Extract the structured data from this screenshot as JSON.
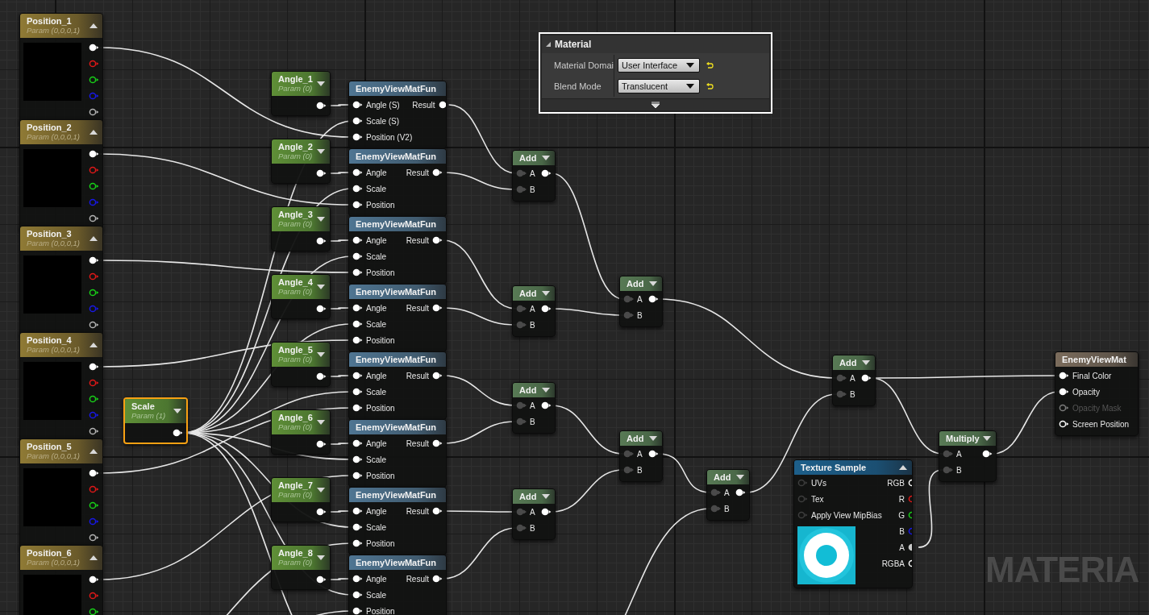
{
  "panel": {
    "title": "Material",
    "expanded": true,
    "rows": [
      {
        "label": "Material Domai",
        "value": "User Interface"
      },
      {
        "label": "Blend Mode",
        "value": "Translucent"
      }
    ]
  },
  "nodes": [
    {
      "kind": "vector_param",
      "title": "Position_1",
      "subtitle": "Param (0,0,0,1)",
      "selected": false,
      "outputs": [
        {
          "color": "#ffffff",
          "connected": true
        },
        {
          "color": "#e01818",
          "connected": false
        },
        {
          "color": "#18d018",
          "connected": false
        },
        {
          "color": "#1818e8",
          "connected": false
        },
        {
          "color": "#b4b4b4",
          "connected": false
        }
      ]
    },
    {
      "kind": "vector_param",
      "title": "Position_2",
      "subtitle": "Param (0,0,0,1)",
      "selected": false,
      "outputs": [
        {
          "color": "#ffffff",
          "connected": true
        },
        {
          "color": "#e01818",
          "connected": false
        },
        {
          "color": "#18d018",
          "connected": false
        },
        {
          "color": "#1818e8",
          "connected": false
        },
        {
          "color": "#b4b4b4",
          "connected": false
        }
      ]
    },
    {
      "kind": "vector_param",
      "title": "Position_3",
      "subtitle": "Param (0,0,0,1)",
      "selected": false,
      "outputs": [
        {
          "color": "#ffffff",
          "connected": true
        },
        {
          "color": "#e01818",
          "connected": false
        },
        {
          "color": "#18d018",
          "connected": false
        },
        {
          "color": "#1818e8",
          "connected": false
        },
        {
          "color": "#b4b4b4",
          "connected": false
        }
      ]
    },
    {
      "kind": "vector_param",
      "title": "Position_4",
      "subtitle": "Param (0,0,0,1)",
      "selected": false,
      "outputs": [
        {
          "color": "#ffffff",
          "connected": true
        },
        {
          "color": "#e01818",
          "connected": false
        },
        {
          "color": "#18d018",
          "connected": false
        },
        {
          "color": "#1818e8",
          "connected": false
        },
        {
          "color": "#b4b4b4",
          "connected": false
        }
      ]
    },
    {
      "kind": "vector_param",
      "title": "Position_5",
      "subtitle": "Param (0,0,0,1)",
      "selected": false,
      "outputs": [
        {
          "color": "#ffffff",
          "connected": true
        },
        {
          "color": "#e01818",
          "connected": false
        },
        {
          "color": "#18d018",
          "connected": false
        },
        {
          "color": "#1818e8",
          "connected": false
        },
        {
          "color": "#b4b4b4",
          "connected": false
        }
      ]
    },
    {
      "kind": "vector_param",
      "title": "Position_6",
      "subtitle": "Param (0,0,0,1)",
      "selected": false,
      "outputs": [
        {
          "color": "#ffffff",
          "connected": true
        },
        {
          "color": "#e01818",
          "connected": false
        },
        {
          "color": "#18d018",
          "connected": false
        }
      ]
    },
    {
      "kind": "scalar_param",
      "title": "Scale",
      "subtitle": "Param (1)",
      "selected": true,
      "output": {
        "connected": true
      }
    },
    {
      "kind": "scalar_param",
      "title": "Angle_1",
      "subtitle": "Param (0)",
      "selected": false,
      "output": {
        "connected": true
      }
    },
    {
      "kind": "scalar_param",
      "title": "Angle_2",
      "subtitle": "Param (0)",
      "selected": false,
      "output": {
        "connected": true
      }
    },
    {
      "kind": "scalar_param",
      "title": "Angle_3",
      "subtitle": "Param (0)",
      "selected": false,
      "output": {
        "connected": true
      }
    },
    {
      "kind": "scalar_param",
      "title": "Angle_4",
      "subtitle": "Param (0)",
      "selected": false,
      "output": {
        "connected": true
      }
    },
    {
      "kind": "scalar_param",
      "title": "Angle_5",
      "subtitle": "Param (0)",
      "selected": false,
      "output": {
        "connected": true
      }
    },
    {
      "kind": "scalar_param",
      "title": "Angle_6",
      "subtitle": "Param (0)",
      "selected": false,
      "output": {
        "connected": true
      }
    },
    {
      "kind": "scalar_param",
      "title": "Angle_7",
      "subtitle": "Param (0)",
      "selected": false,
      "output": {
        "connected": true
      }
    },
    {
      "kind": "scalar_param",
      "title": "Angle_8",
      "subtitle": "Param (0)",
      "selected": false,
      "output": {
        "connected": true
      }
    },
    {
      "kind": "function_call",
      "title": "EnemyViewMatFun",
      "inputs": [
        {
          "label": "Angle (S)",
          "connected": true
        },
        {
          "label": "Scale (S)",
          "connected": true
        },
        {
          "label": "Position (V2)",
          "connected": true
        }
      ],
      "outputs": [
        {
          "label": "Result",
          "connected": true
        }
      ]
    },
    {
      "kind": "function_call",
      "title": "EnemyViewMatFun",
      "inputs": [
        {
          "label": "Angle",
          "connected": true
        },
        {
          "label": "Scale",
          "connected": true
        },
        {
          "label": "Position",
          "connected": true
        }
      ],
      "outputs": [
        {
          "label": "Result",
          "connected": true
        }
      ]
    },
    {
      "kind": "function_call",
      "title": "EnemyViewMatFun",
      "inputs": [
        {
          "label": "Angle",
          "connected": true
        },
        {
          "label": "Scale",
          "connected": true
        },
        {
          "label": "Position",
          "connected": true
        }
      ],
      "outputs": [
        {
          "label": "Result",
          "connected": true
        }
      ]
    },
    {
      "kind": "function_call",
      "title": "EnemyViewMatFun",
      "inputs": [
        {
          "label": "Angle",
          "connected": true
        },
        {
          "label": "Scale",
          "connected": true
        },
        {
          "label": "Position",
          "connected": true
        }
      ],
      "outputs": [
        {
          "label": "Result",
          "connected": true
        }
      ]
    },
    {
      "kind": "function_call",
      "title": "EnemyViewMatFun",
      "inputs": [
        {
          "label": "Angle",
          "connected": true
        },
        {
          "label": "Scale",
          "connected": true
        },
        {
          "label": "Position",
          "connected": true
        }
      ],
      "outputs": [
        {
          "label": "Result",
          "connected": true
        }
      ]
    },
    {
      "kind": "function_call",
      "title": "EnemyViewMatFun",
      "inputs": [
        {
          "label": "Angle",
          "connected": true
        },
        {
          "label": "Scale",
          "connected": true
        },
        {
          "label": "Position",
          "connected": true
        }
      ],
      "outputs": [
        {
          "label": "Result",
          "connected": true
        }
      ]
    },
    {
      "kind": "function_call",
      "title": "EnemyViewMatFun",
      "inputs": [
        {
          "label": "Angle",
          "connected": true
        },
        {
          "label": "Scale",
          "connected": true
        },
        {
          "label": "Position",
          "connected": true
        }
      ],
      "outputs": [
        {
          "label": "Result",
          "connected": true
        }
      ]
    },
    {
      "kind": "function_call",
      "title": "EnemyViewMatFun",
      "inputs": [
        {
          "label": "Angle",
          "connected": true
        },
        {
          "label": "Scale",
          "connected": true
        },
        {
          "label": "Position",
          "connected": true
        }
      ],
      "outputs": [
        {
          "label": "Result",
          "connected": true
        }
      ]
    },
    {
      "kind": "math",
      "title": "Add",
      "inputs": [
        {
          "label": "A",
          "connected": true
        },
        {
          "label": "B",
          "connected": true
        }
      ],
      "output": {
        "connected": true
      }
    },
    {
      "kind": "math",
      "title": "Add",
      "inputs": [
        {
          "label": "A",
          "connected": true
        },
        {
          "label": "B",
          "connected": true
        }
      ],
      "output": {
        "connected": true
      }
    },
    {
      "kind": "math",
      "title": "Add",
      "inputs": [
        {
          "label": "A",
          "connected": true
        },
        {
          "label": "B",
          "connected": true
        }
      ],
      "output": {
        "connected": true
      }
    },
    {
      "kind": "math",
      "title": "Add",
      "inputs": [
        {
          "label": "A",
          "connected": true
        },
        {
          "label": "B",
          "connected": true
        }
      ],
      "output": {
        "connected": true
      }
    },
    {
      "kind": "math",
      "title": "Add",
      "inputs": [
        {
          "label": "A",
          "connected": true
        },
        {
          "label": "B",
          "connected": true
        }
      ],
      "output": {
        "connected": true
      }
    },
    {
      "kind": "math",
      "title": "Add",
      "inputs": [
        {
          "label": "A",
          "connected": true
        },
        {
          "label": "B",
          "connected": true
        }
      ],
      "output": {
        "connected": true
      }
    },
    {
      "kind": "math",
      "title": "Add",
      "inputs": [
        {
          "label": "A",
          "connected": true
        },
        {
          "label": "B",
          "connected": true
        }
      ],
      "output": {
        "connected": true
      }
    },
    {
      "kind": "math",
      "title": "Add",
      "inputs": [
        {
          "label": "A",
          "connected": true
        },
        {
          "label": "B",
          "connected": true
        }
      ],
      "output": {
        "connected": true
      }
    },
    {
      "kind": "math",
      "title": "Multiply",
      "inputs": [
        {
          "label": "A",
          "connected": true
        },
        {
          "label": "B",
          "connected": true
        }
      ],
      "output": {
        "connected": true
      }
    },
    {
      "kind": "texture_sample",
      "title": "Texture Sample",
      "inputs": [
        {
          "label": "UVs",
          "connected": false
        },
        {
          "label": "Tex",
          "connected": false
        },
        {
          "label": "Apply View MipBias",
          "connected": false
        }
      ],
      "outputs": [
        {
          "label": "RGB",
          "color": "#ffffff",
          "connected": false
        },
        {
          "label": "R",
          "color": "#e01818",
          "connected": false
        },
        {
          "label": "G",
          "color": "#18d018",
          "connected": false
        },
        {
          "label": "B",
          "color": "#1818e8",
          "connected": false
        },
        {
          "label": "A",
          "color": "#c8c8c8",
          "connected": true
        },
        {
          "label": "RGBA",
          "color": "#ffffff",
          "connected": false
        }
      ]
    },
    {
      "kind": "result",
      "title": "EnemyViewMat",
      "inputs": [
        {
          "label": "Final Color",
          "connected": true,
          "disabled": false
        },
        {
          "label": "Opacity",
          "connected": true,
          "disabled": false
        },
        {
          "label": "Opacity Mask",
          "connected": false,
          "disabled": true
        },
        {
          "label": "Screen Position",
          "connected": false,
          "disabled": false
        }
      ]
    }
  ],
  "graph_label": "MATERIA"
}
